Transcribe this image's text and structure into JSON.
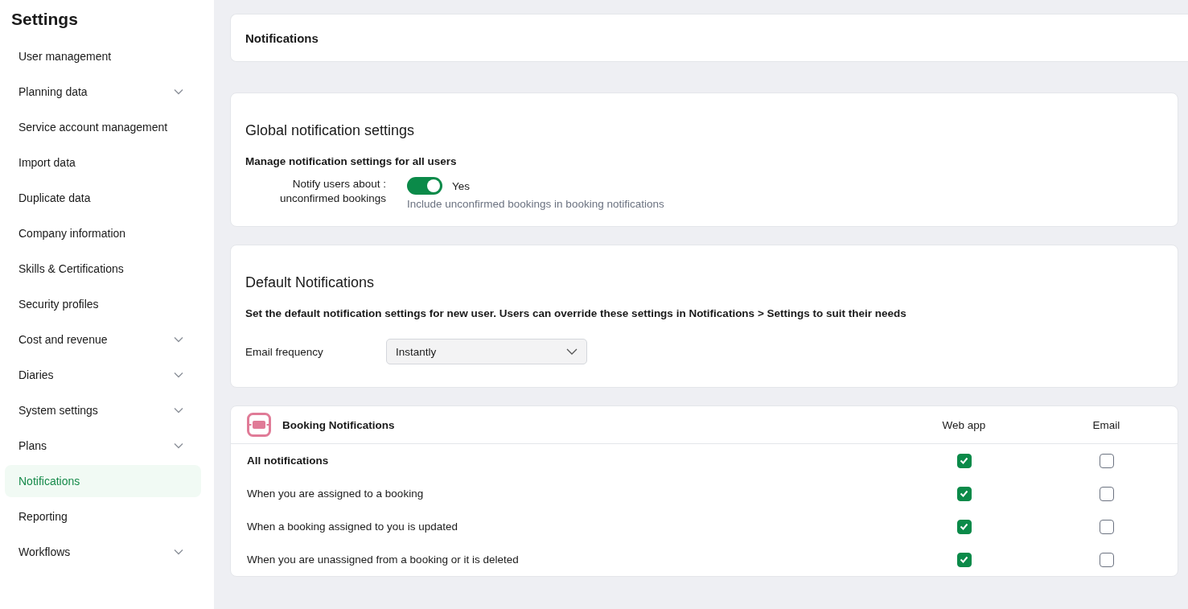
{
  "sidebar": {
    "title": "Settings",
    "items": [
      {
        "label": "User management",
        "expandable": false,
        "selected": false
      },
      {
        "label": "Planning data",
        "expandable": true,
        "selected": false
      },
      {
        "label": "Service account management",
        "expandable": false,
        "selected": false
      },
      {
        "label": "Import data",
        "expandable": false,
        "selected": false
      },
      {
        "label": "Duplicate data",
        "expandable": false,
        "selected": false
      },
      {
        "label": "Company information",
        "expandable": false,
        "selected": false
      },
      {
        "label": "Skills & Certifications",
        "expandable": false,
        "selected": false
      },
      {
        "label": "Security profiles",
        "expandable": false,
        "selected": false
      },
      {
        "label": "Cost and revenue",
        "expandable": true,
        "selected": false
      },
      {
        "label": "Diaries",
        "expandable": true,
        "selected": false
      },
      {
        "label": "System settings",
        "expandable": true,
        "selected": false
      },
      {
        "label": "Plans",
        "expandable": true,
        "selected": false
      },
      {
        "label": "Notifications",
        "expandable": false,
        "selected": true
      },
      {
        "label": "Reporting",
        "expandable": false,
        "selected": false
      },
      {
        "label": "Workflows",
        "expandable": true,
        "selected": false
      }
    ]
  },
  "page_title": "Notifications",
  "global_settings": {
    "title": "Global notification settings",
    "subtitle": "Manage notification settings for all users",
    "toggle": {
      "label_line1": "Notify users about :",
      "label_line2": "unconfirmed bookings",
      "on": true,
      "value": "Yes",
      "help": "Include unconfirmed bookings in booking notifications"
    }
  },
  "default_notifications": {
    "title": "Default Notifications",
    "description": "Set the default notification settings for new user. Users can override these settings in Notifications > Settings to suit their needs",
    "email_frequency": {
      "label": "Email frequency",
      "value": "Instantly"
    }
  },
  "booking_table": {
    "title": "Booking Notifications",
    "columns": [
      "Web app",
      "Email"
    ],
    "rows": [
      {
        "label": "All notifications",
        "bold": true,
        "web_app": true,
        "email": false
      },
      {
        "label": "When you are assigned to a booking",
        "bold": false,
        "web_app": true,
        "email": false
      },
      {
        "label": "When a booking assigned to you is updated",
        "bold": false,
        "web_app": true,
        "email": false
      },
      {
        "label": "When you are unassigned from a booking or it is deleted",
        "bold": false,
        "web_app": true,
        "email": false
      }
    ]
  }
}
